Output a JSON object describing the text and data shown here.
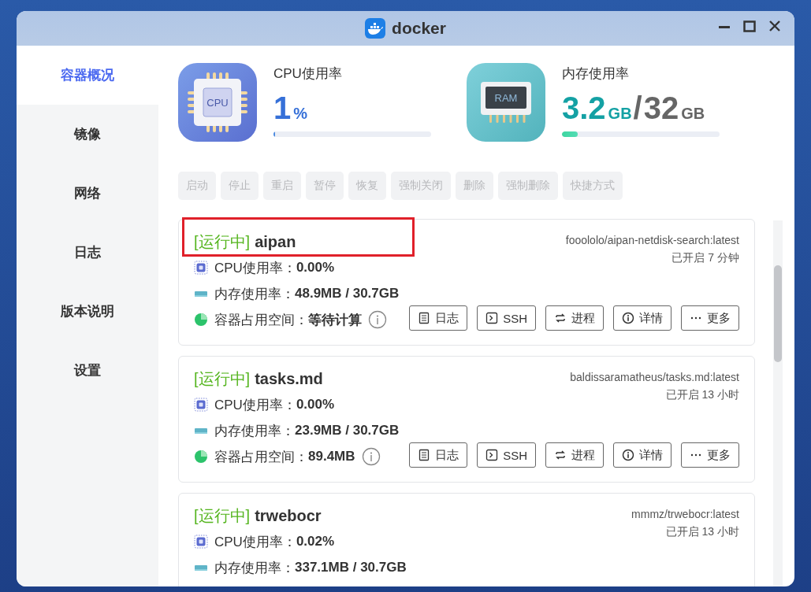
{
  "window": {
    "title": "docker"
  },
  "sidebar": {
    "items": [
      {
        "label": "容器概况",
        "selected": true
      },
      {
        "label": "镜像",
        "selected": false
      },
      {
        "label": "网络",
        "selected": false
      },
      {
        "label": "日志",
        "selected": false
      },
      {
        "label": "版本说明",
        "selected": false
      },
      {
        "label": "设置",
        "selected": false
      }
    ]
  },
  "stats": [
    {
      "kind": "cpu",
      "icon_text": "CPU",
      "label": "CPU使用率",
      "value": "1",
      "unit": "%",
      "level": 0.01
    },
    {
      "kind": "memory",
      "icon_text": "RAM",
      "label": "内存使用率",
      "value": "3.2",
      "unit": "GB",
      "separator": "/",
      "total": "32",
      "total_unit": "GB",
      "level": 0.1
    }
  ],
  "toolbar": [
    {
      "label": "启动",
      "disabled": true
    },
    {
      "label": "停止",
      "disabled": true
    },
    {
      "label": "重启",
      "disabled": true
    },
    {
      "label": "暂停",
      "disabled": true
    },
    {
      "label": "恢复",
      "disabled": true
    },
    {
      "label": "强制关闭",
      "disabled": true
    },
    {
      "label": "删除",
      "disabled": true
    },
    {
      "label": "强制删除",
      "disabled": true
    },
    {
      "label": "快捷方式",
      "disabled": true
    }
  ],
  "containers": [
    {
      "status": "[运行中]",
      "name": "aipan",
      "highlighted": true,
      "image": "fooololo/aipan-netdisk-search:latest",
      "uptime": "已开启 7 分钟",
      "metrics": [
        {
          "kind": "cpu",
          "label": "CPU使用率：",
          "value": "0.00%"
        },
        {
          "kind": "memory",
          "label": "内存使用率：",
          "value": "48.9MB / 30.7GB"
        },
        {
          "kind": "disk",
          "label": "容器占用空间：",
          "value": "等待计算",
          "info": true
        }
      ],
      "actions": [
        {
          "kind": "log",
          "label": "日志"
        },
        {
          "kind": "ssh",
          "label": "SSH"
        },
        {
          "kind": "process",
          "label": "进程"
        },
        {
          "kind": "details",
          "label": "详情"
        },
        {
          "kind": "more",
          "label": "更多"
        }
      ]
    },
    {
      "status": "[运行中]",
      "name": "tasks.md",
      "highlighted": false,
      "image": "baldissaramatheus/tasks.md:latest",
      "uptime": "已开启 13 小时",
      "metrics": [
        {
          "kind": "cpu",
          "label": "CPU使用率：",
          "value": "0.00%"
        },
        {
          "kind": "memory",
          "label": "内存使用率：",
          "value": "23.9MB / 30.7GB"
        },
        {
          "kind": "disk",
          "label": "容器占用空间：",
          "value": "89.4MB",
          "info": true
        }
      ],
      "actions": [
        {
          "kind": "log",
          "label": "日志"
        },
        {
          "kind": "ssh",
          "label": "SSH"
        },
        {
          "kind": "process",
          "label": "进程"
        },
        {
          "kind": "details",
          "label": "详情"
        },
        {
          "kind": "more",
          "label": "更多"
        }
      ]
    },
    {
      "status": "[运行中]",
      "name": "trwebocr",
      "highlighted": false,
      "image": "mmmz/trwebocr:latest",
      "uptime": "已开启 13 小时",
      "metrics": [
        {
          "kind": "cpu",
          "label": "CPU使用率：",
          "value": "0.02%"
        },
        {
          "kind": "memory",
          "label": "内存使用率：",
          "value": "337.1MB / 30.7GB"
        }
      ]
    }
  ]
}
